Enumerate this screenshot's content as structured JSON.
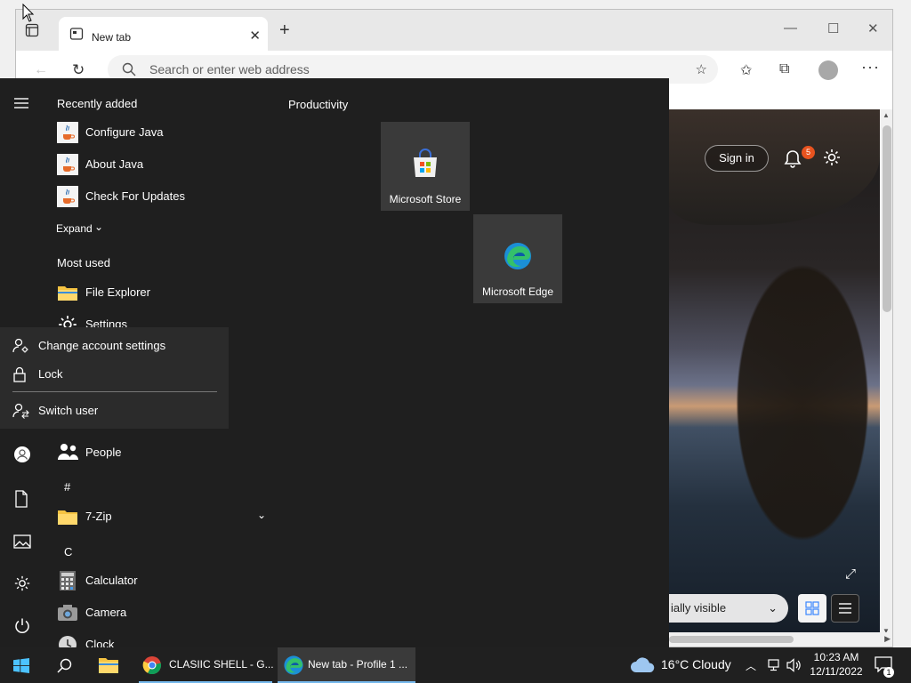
{
  "browser": {
    "tab_title": "New tab",
    "address_placeholder": "Search or enter web address",
    "sign_in_label": "Sign in",
    "notification_count": "5",
    "visibility_label": "ially visible"
  },
  "start_menu": {
    "recently_added_heading": "Recently added",
    "recently_added": [
      {
        "label": "Configure Java",
        "icon": "java-icon"
      },
      {
        "label": "About Java",
        "icon": "java-icon"
      },
      {
        "label": "Check For Updates",
        "icon": "java-icon"
      }
    ],
    "expand_label": "Expand",
    "most_used_heading": "Most used",
    "most_used": [
      {
        "label": "File Explorer",
        "icon": "folder-icon"
      },
      {
        "label": "Settings",
        "icon": "gear-icon"
      }
    ],
    "people_label": "People",
    "letter_hash": "#",
    "seven_zip_label": "7-Zip",
    "letter_c": "C",
    "calculator_label": "Calculator",
    "camera_label": "Camera",
    "clock_label": "Clock",
    "tiles_heading": "Productivity",
    "tiles": [
      {
        "label": "Microsoft Store",
        "icon": "store-icon"
      },
      {
        "label": "Microsoft Edge",
        "icon": "edge-icon"
      }
    ],
    "account_menu": {
      "change_settings": "Change account settings",
      "lock": "Lock",
      "switch_user": "Switch user"
    }
  },
  "taskbar": {
    "chrome_label": "CLASIIC SHELL - G...",
    "edge_label": "New tab - Profile 1 ...",
    "weather": "16°C  Cloudy",
    "time": "10:23 AM",
    "date": "12/11/2022",
    "notification_count": "1"
  },
  "colors": {
    "start_bg": "#1f1f1f",
    "taskbar_bg": "#202020",
    "tile_bg": "#3a3a3a",
    "accent": "#76b9ed",
    "badge": "#e8531f"
  }
}
